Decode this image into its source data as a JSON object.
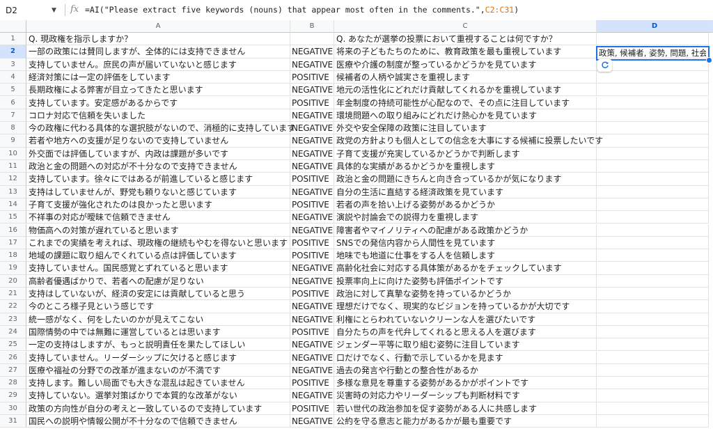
{
  "formula_bar": {
    "cell_ref": "D2",
    "formula_prefix": "=AI(\"Please extract five keywords (nouns) that appear most often in the comments.\",",
    "formula_ref": "C2:C31",
    "formula_suffix": ")"
  },
  "columns": [
    "A",
    "B",
    "C",
    "D"
  ],
  "rows": [
    {
      "n": "1",
      "a": "Q. 現政権を指示しますか？",
      "b": "",
      "c": "Q. あなたが選挙の投票において重視することは何ですか？"
    },
    {
      "n": "2",
      "a": "一部の政策には賛同しますが、全体的には支持できません",
      "b": "NEGATIVE",
      "c": "将来の子どもたちのために、教育政策を最も重視しています"
    },
    {
      "n": "3",
      "a": "支持していません。庶民の声が届いていないと感じます",
      "b": "NEGATIVE",
      "c": "医療や介護の制度が整っているかどうかを見ています"
    },
    {
      "n": "4",
      "a": "経済対策には一定の評価をしています",
      "b": "POSITIVE",
      "c": "候補者の人柄や誠実さを重視します"
    },
    {
      "n": "5",
      "a": "長期政権による弊害が目立ってきたと思います",
      "b": "NEGATIVE",
      "c": "地元の活性化にどれだけ貢献してくれるかを重視しています"
    },
    {
      "n": "6",
      "a": "支持しています。安定感があるからです",
      "b": "POSITIVE",
      "c": "年金制度の持続可能性が心配なので、その点に注目しています"
    },
    {
      "n": "7",
      "a": "コロナ対応で信頼を失いました",
      "b": "NEGATIVE",
      "c": "環境問題への取り組みにどれだけ熱心かを見ています"
    },
    {
      "n": "8",
      "a": "今の政権に代わる具体的な選択肢がないので、消極的に支持しています",
      "b": "NEGATIVE",
      "c": "外交や安全保障の政策に注目しています"
    },
    {
      "n": "9",
      "a": "若者や地方への支援が足りないので支持していません",
      "b": "NEGATIVE",
      "c": "政党の方針よりも個人としての信念を大事にする候補に投票したいです"
    },
    {
      "n": "10",
      "a": "外交面では評価していますが、内政は課題が多いです",
      "b": "NEGATIVE",
      "c": "子育て支援が充実しているかどうかで判断します"
    },
    {
      "n": "11",
      "a": "政治と金の問題への対応が不十分なので支持できません",
      "b": "NEGATIVE",
      "c": "具体的な実績があるかどうかを重視します"
    },
    {
      "n": "12",
      "a": "支持しています。徐々にではあるが前進していると感じます",
      "b": "POSITIVE",
      "c": "政治と金の問題にきちんと向き合っているかが気になります"
    },
    {
      "n": "13",
      "a": "支持はしていませんが、野党も頼りないと感じています",
      "b": "NEGATIVE",
      "c": "自分の生活に直結する経済政策を見ています"
    },
    {
      "n": "14",
      "a": "子育て支援が強化されたのは良かったと思います",
      "b": "POSITIVE",
      "c": "若者の声を拾い上げる姿勢があるかどうか"
    },
    {
      "n": "15",
      "a": "不祥事の対応が曖昧で信頼できません",
      "b": "NEGATIVE",
      "c": "演説や討論会での説得力を重視します"
    },
    {
      "n": "16",
      "a": "物価高への対策が遅れていると思います",
      "b": "NEGATIVE",
      "c": "障害者やマイノリティへの配慮がある政策かどうか"
    },
    {
      "n": "17",
      "a": "これまでの実績を考えれば、現政権の継続もやむを得ないと思います",
      "b": "POSITIVE",
      "c": "SNSでの発信内容から人間性を見ています"
    },
    {
      "n": "18",
      "a": "地域の課題に取り組んでくれている点は評価しています",
      "b": "POSITIVE",
      "c": "地味でも地道に仕事をする人を信頼します"
    },
    {
      "n": "19",
      "a": "支持していません。国民感覚とずれていると思います",
      "b": "NEGATIVE",
      "c": "高齢化社会に対応する具体策があるかをチェックしています"
    },
    {
      "n": "20",
      "a": "高齢者優遇ばかりで、若者への配慮が足りない",
      "b": "NEGATIVE",
      "c": "投票率向上に向けた姿勢も評価ポイントです"
    },
    {
      "n": "21",
      "a": "支持はしていないが、経済の安定には貢献していると思う",
      "b": "POSITIVE",
      "c": "政治に対して真摯な姿勢を持っているかどうか"
    },
    {
      "n": "22",
      "a": "今のところ様子見という感じです",
      "b": "NEGATIVE",
      "c": "理想だけでなく、現実的なビジョンを持っているかが大切です"
    },
    {
      "n": "23",
      "a": "統一感がなく、何をしたいのかが見えてこない",
      "b": "NEGATIVE",
      "c": "利権にとらわれていないクリーンな人を選びたいです"
    },
    {
      "n": "24",
      "a": "国際情勢の中では無難に運営しているとは思います",
      "b": "POSITIVE",
      "c": "自分たちの声を代弁してくれると思える人を選びます"
    },
    {
      "n": "25",
      "a": "一定の支持はしますが、もっと説明責任を果たしてほしい",
      "b": "NEGATIVE",
      "c": "ジェンダー平等に取り組む姿勢に注目しています"
    },
    {
      "n": "26",
      "a": "支持していません。リーダーシップに欠けると感じます",
      "b": "NEGATIVE",
      "c": "口だけでなく、行動で示しているかを見ます"
    },
    {
      "n": "27",
      "a": "医療や福祉の分野での改革が進まないのが不満です",
      "b": "NEGATIVE",
      "c": "過去の発言や行動との整合性があるか"
    },
    {
      "n": "28",
      "a": "支持します。難しい局面でも大きな混乱は起きていません",
      "b": "POSITIVE",
      "c": "多様な意見を尊重する姿勢があるかがポイントです"
    },
    {
      "n": "29",
      "a": "支持していない。選挙対策ばかりで本質的な改革がない",
      "b": "NEGATIVE",
      "c": "災害時の対応力やリーダーシップも判断材料です"
    },
    {
      "n": "30",
      "a": "政策の方向性が自分の考えと一致しているので支持しています",
      "b": "POSITIVE",
      "c": "若い世代の政治参加を促す姿勢がある人に共感します"
    },
    {
      "n": "31",
      "a": "国民への説明や情報公開が不十分なので信頼できません",
      "b": "NEGATIVE",
      "c": "公約を守る意志と能力があるかが最も重要です"
    }
  ],
  "d2_value": "政策, 候補者, 姿勢, 問題, 社会",
  "icons": {
    "refresh": "refresh-icon",
    "caret": "chevron-down-icon",
    "fx": "fx-icon"
  }
}
